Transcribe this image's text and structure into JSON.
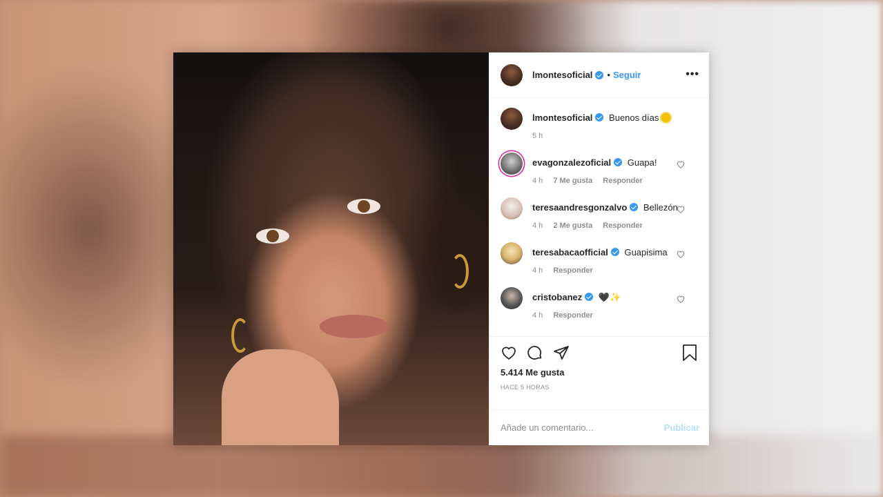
{
  "post": {
    "author": "lmontesoficial",
    "follow_separator": "•",
    "follow_label": "Seguir",
    "more_icon": "more-dots-icon"
  },
  "caption": {
    "username": "lmontesoficial",
    "text": "Buenos días",
    "emoji": "sun",
    "time": "5 h"
  },
  "comments": [
    {
      "username": "evagonzalezoficial",
      "text": "Guapa!",
      "time": "4 h",
      "likes": "7 Me gusta",
      "reply": "Responder"
    },
    {
      "username": "teresaandresgonzalvo",
      "text": "Bellezón",
      "time": "4 h",
      "likes": "2 Me gusta",
      "reply": "Responder"
    },
    {
      "username": "teresabacaofficial",
      "text": "Guapisima",
      "time": "4 h",
      "reply": "Responder"
    },
    {
      "username": "cristobanez",
      "text": "🖤",
      "emoji_extra": "✨",
      "time": "4 h",
      "reply": "Responder"
    }
  ],
  "footer": {
    "likes": "5.414 Me gusta",
    "time_ago": "HACE 5 HORAS",
    "comment_placeholder": "Añade un comentario...",
    "publish_label": "Publicar"
  },
  "colors": {
    "link_blue": "#3897f0",
    "publish_disabled": "#b2dffc",
    "text": "#262626",
    "muted": "#8e8e8e"
  }
}
